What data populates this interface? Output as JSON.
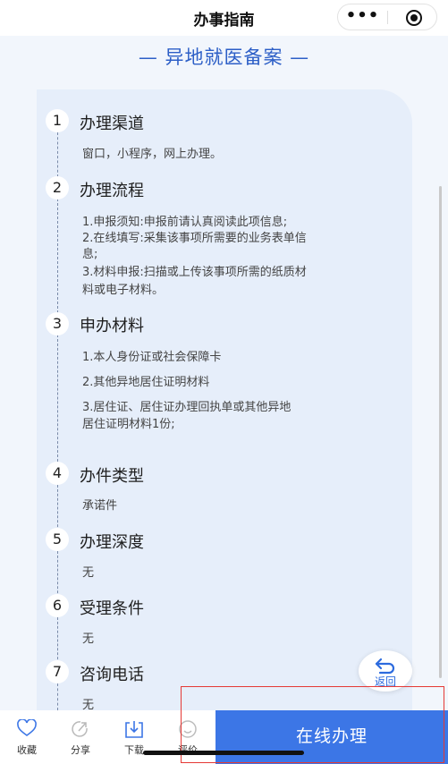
{
  "nav": {
    "title": "办事指南",
    "more_label": "•••"
  },
  "heading": "— 异地就医备案 —",
  "sections": [
    {
      "num": "1",
      "title": "办理渠道",
      "lines": [
        "窗口，小程序，网上办理。"
      ]
    },
    {
      "num": "2",
      "title": "办理流程",
      "lines": [
        "1.申报须知:申报前请认真阅读此项信息;",
        "2.在线填写:采集该事项所需要的业务表单信",
        "息;",
        "3.材料申报:扫描或上传该事项所需的纸质材",
        "料或电子材料。"
      ]
    },
    {
      "num": "3",
      "title": "申办材料",
      "lines": [
        "1.本人身份证或社会保障卡",
        "2.其他异地居住证明材料",
        "3.居住证、居住证办理回执单或其他异地",
        "居住证明材料1份;"
      ]
    },
    {
      "num": "4",
      "title": "办件类型",
      "lines": [
        "承诺件"
      ]
    },
    {
      "num": "5",
      "title": "办理深度",
      "lines": [
        "无"
      ]
    },
    {
      "num": "6",
      "title": "受理条件",
      "lines": [
        "无"
      ]
    },
    {
      "num": "7",
      "title": "咨询电话",
      "lines": [
        "无"
      ]
    }
  ],
  "return_label": "返回",
  "toolbar": {
    "collect": {
      "label": "收藏",
      "icon": "heart-icon"
    },
    "share": {
      "label": "分享",
      "icon": "share-icon"
    },
    "download": {
      "label": "下载",
      "icon": "download-icon"
    },
    "rate": {
      "label": "评价",
      "icon": "smile-icon"
    },
    "apply_label": "在线办理"
  },
  "colors": {
    "accent": "#3c76e6",
    "heading": "#2d5fc7",
    "card": "#e6eefa"
  }
}
